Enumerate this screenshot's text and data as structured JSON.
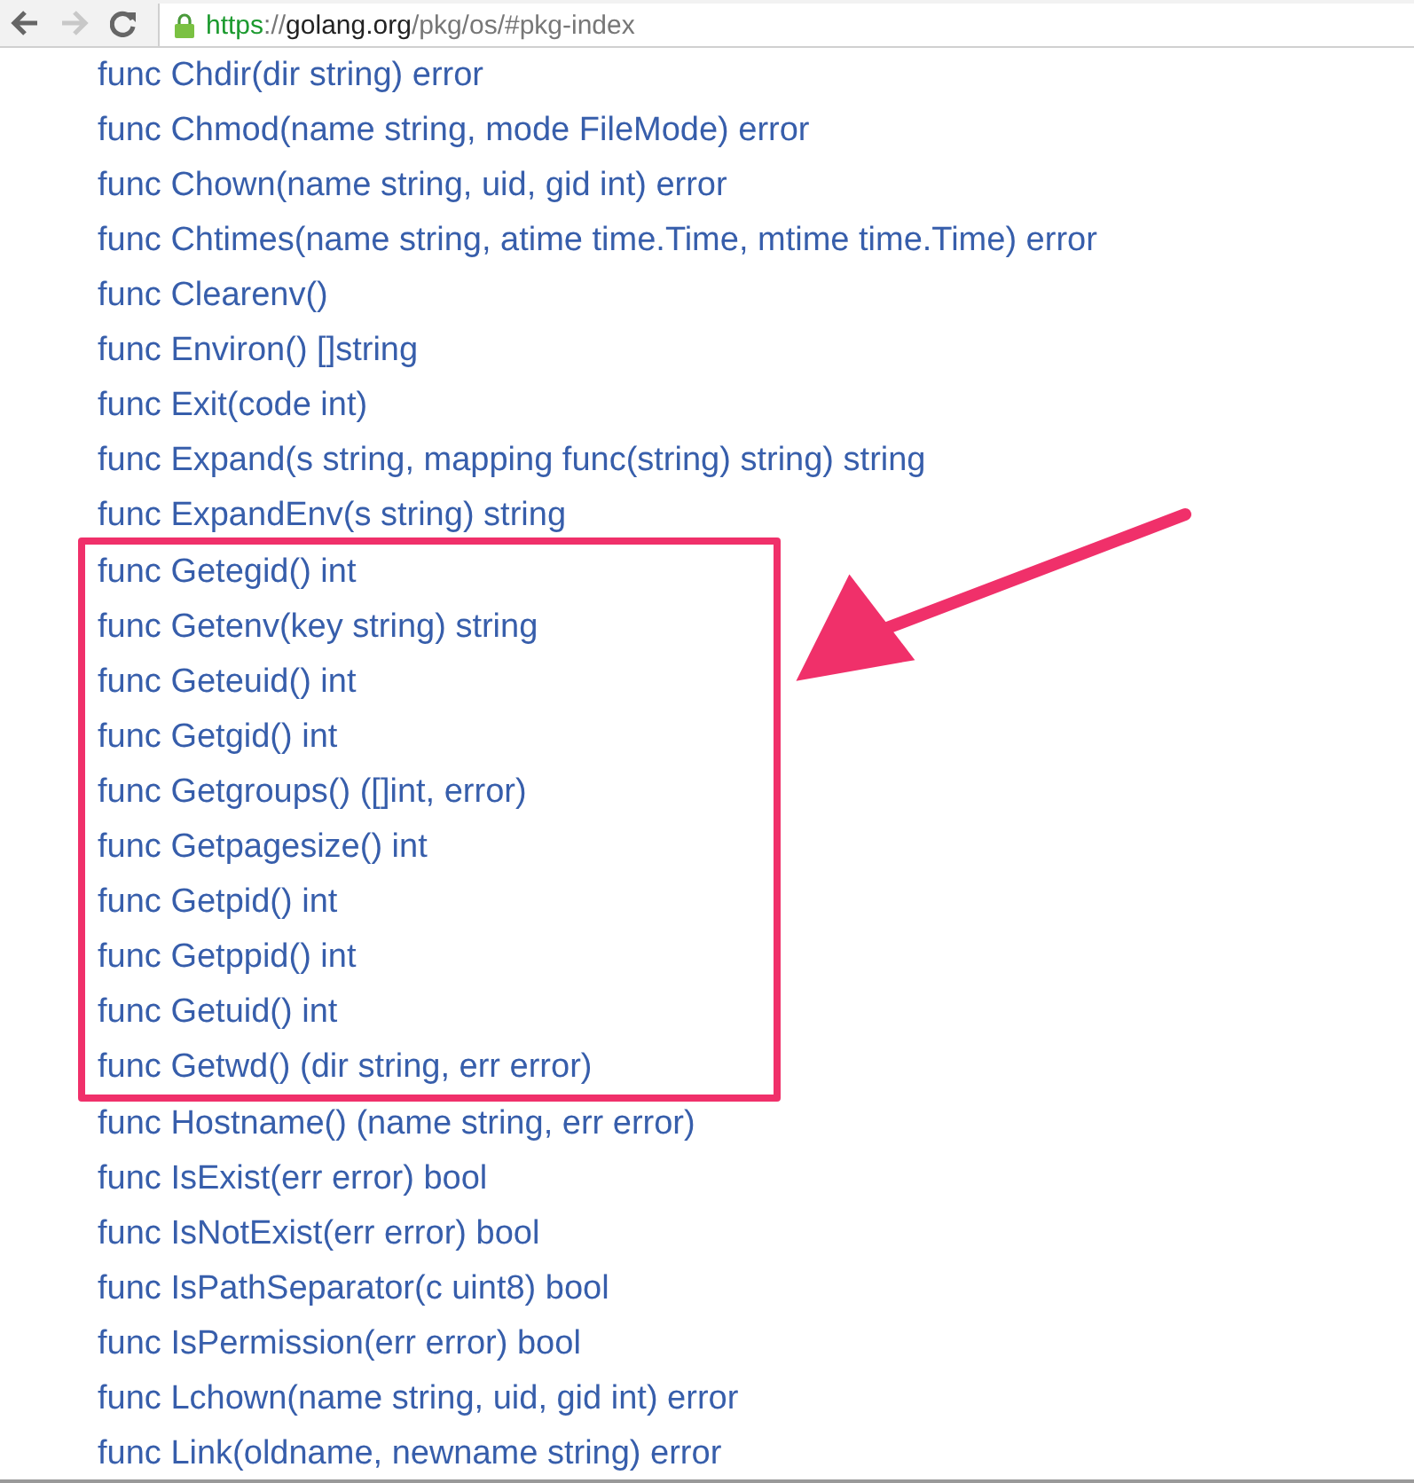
{
  "toolbar": {
    "url": {
      "scheme": "https",
      "separator": "://",
      "host": "golang.org",
      "path": "/pkg/os/#pkg-index"
    },
    "back_disabled": false,
    "forward_disabled": true
  },
  "functions_before": [
    "func Chdir(dir string) error",
    "func Chmod(name string, mode FileMode) error",
    "func Chown(name string, uid, gid int) error",
    "func Chtimes(name string, atime time.Time, mtime time.Time) error",
    "func Clearenv()",
    "func Environ() []string",
    "func Exit(code int)",
    "func Expand(s string, mapping func(string) string) string",
    "func ExpandEnv(s string) string"
  ],
  "highlight_box": {
    "functions": [
      "func Getegid() int",
      "func Getenv(key string) string",
      "func Geteuid() int",
      "func Getgid() int",
      "func Getgroups() ([]int, error)",
      "func Getpagesize() int",
      "func Getpid() int",
      "func Getppid() int",
      "func Getuid() int",
      "func Getwd() (dir string, err error)"
    ]
  },
  "functions_after": [
    "func Hostname() (name string, err error)",
    "func IsExist(err error) bool",
    "func IsNotExist(err error) bool",
    "func IsPathSeparator(c uint8) bool",
    "func IsPermission(err error) bool",
    "func Lchown(name string, uid, gid int) error",
    "func Link(oldname, newname string) error"
  ]
}
